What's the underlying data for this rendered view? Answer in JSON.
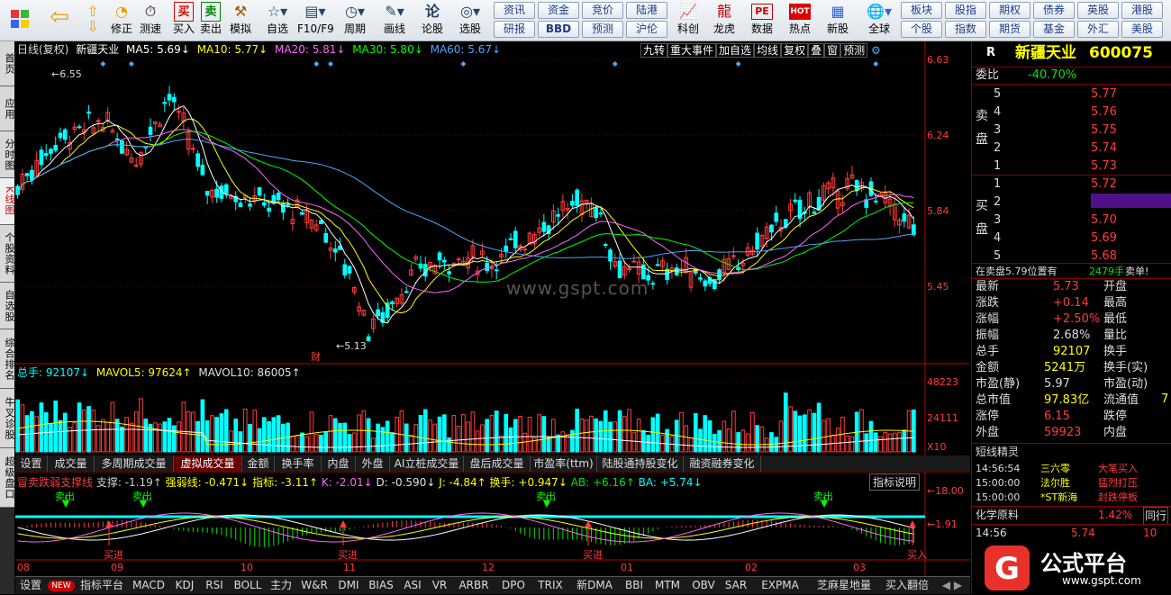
{
  "toolbar": {
    "buttons": [
      {
        "label": "",
        "icon": "windows-logo-icon"
      },
      {
        "label": "",
        "icon": "back-arrow-icon"
      },
      {
        "label": "",
        "icon": "up-down-arrows-icon"
      },
      {
        "label": "修正",
        "icon": "revise-icon"
      },
      {
        "label": "测速",
        "icon": "clock-icon"
      },
      {
        "label": "买入",
        "icon": "buy-icon",
        "glyph": "买"
      },
      {
        "label": "卖出",
        "icon": "sell-icon",
        "glyph": "卖"
      },
      {
        "label": "模拟",
        "icon": "gavel-icon"
      },
      {
        "label": "自选",
        "icon": "star-folder-icon"
      },
      {
        "label": "F10/F9",
        "icon": "window-icon"
      },
      {
        "label": "周期",
        "icon": "cycle-icon"
      },
      {
        "label": "画线",
        "icon": "pencil-icon"
      },
      {
        "label": "论股",
        "icon": "discuss-icon"
      },
      {
        "label": "选股",
        "icon": "stock-select-icon"
      }
    ],
    "grid": [
      [
        "资讯",
        "资金",
        "竞价",
        "陆港"
      ],
      [
        "研报",
        "BBD",
        "预测",
        "沪伦"
      ]
    ],
    "grid2": [
      [
        "板块",
        "股指",
        "期权",
        "债券",
        "英股",
        "港股"
      ],
      [
        "个股",
        "指数",
        "期货",
        "基金",
        "外汇",
        "美股"
      ]
    ],
    "buttons2": [
      {
        "label": "科创",
        "icon": "chart-icon"
      },
      {
        "label": "龙虎",
        "icon": "dragon-tiger-icon"
      },
      {
        "label": "数据",
        "icon": "pe-icon",
        "glyph": "PE"
      },
      {
        "label": "热点",
        "icon": "hot-icon",
        "glyph": "HOT"
      },
      {
        "label": "新股",
        "icon": "new-stock-icon"
      },
      {
        "label": "全球",
        "icon": "globe-icon"
      }
    ]
  },
  "left_tabs": [
    "首页",
    "应用",
    "分时图",
    "K线图",
    "个股资料",
    "自选股",
    "综合排名",
    "牛叉诊股",
    "超级盘口"
  ],
  "chart": {
    "header": {
      "title": "日线(复权)",
      "name": "新疆天业",
      "ma5": "MA5: 5.69↓",
      "ma10": "MA10: 5.77↓",
      "ma20": "MA20: 5.81↓",
      "ma30": "MA30: 5.80↓",
      "ma60": "MA60: 5.67↓"
    },
    "top_buttons": [
      "九转",
      "重大事件",
      "加自选",
      "均线",
      "复权",
      "叠",
      "窗",
      "预测"
    ],
    "price_axis": [
      "6.63",
      "6.24",
      "5.84",
      "5.45"
    ],
    "high_label": "6.55",
    "low_label": "5.13",
    "fin_mark": "财",
    "watermark": "www.gspt.com",
    "vol_header": {
      "total": "总手: 92107↓",
      "mavol5": "MAVOL5: 97624↑",
      "mavol10": "MAVOL10: 86005↑"
    },
    "vol_axis": [
      "48223",
      "24111",
      "X10"
    ],
    "indicator_tabs": [
      "设置",
      "成交量",
      "多周期成交量",
      "虚拟成交量",
      "金额",
      "换手率",
      "内盘",
      "外盘",
      "AI立桩成交量",
      "盘后成交量",
      "市盈率(ttm)",
      "陆股通持股变化",
      "融资融券变化"
    ],
    "indicator_active": 3,
    "ind_header": {
      "name": "冒卖跌弱支撑线",
      "support": "支撑: -1.19↑",
      "strong": "强弱线: -0.471↓",
      "index": "指标: -3.11↑",
      "k": "K: -2.01↓",
      "d": "D: -0.590↓",
      "j": "J: -4.84↑",
      "turn": "换手: +0.947↓",
      "ab": "AB: +6.16↑",
      "ba": "BA: +5.74↓"
    },
    "ind_explain": "指标说明",
    "ind_axis": [
      "18.00",
      "1.91"
    ],
    "sell_marks": [
      "卖出",
      "卖出",
      "卖出",
      "卖出"
    ],
    "buy_marks": [
      "买进",
      "买进",
      "买进",
      "买进",
      "买入"
    ],
    "x_labels": [
      "08",
      "09",
      "10",
      "11",
      "12",
      "01",
      "02",
      "03"
    ]
  },
  "bottom_tabs": [
    "设置",
    "指标平台",
    "MACD",
    "KDJ",
    "RSI",
    "BOLL",
    "主力",
    "W&R",
    "DMI",
    "BIAS",
    "ASI",
    "VR",
    "ARBR",
    "DPO",
    "TRIX",
    "新DMA",
    "BBI",
    "MTM",
    "OBV",
    "SAR",
    "EXPMA",
    "芝麻星地量",
    "买入翻倍"
  ],
  "bottom_new_badge": "NEW",
  "quote": {
    "r": "R",
    "stock_name": "新疆天业",
    "code": "600075",
    "weibi_label": "委比",
    "weibi": "-40.70%",
    "sell_label": "卖盘",
    "sells": [
      [
        "5",
        "5.77"
      ],
      [
        "4",
        "5.76"
      ],
      [
        "3",
        "5.75"
      ],
      [
        "2",
        "5.74"
      ],
      [
        "1",
        "5.73"
      ]
    ],
    "buy_label": "买盘",
    "buys": [
      [
        "1",
        "5.72"
      ],
      [
        "2",
        "5.71"
      ],
      [
        "3",
        "5.70"
      ],
      [
        "4",
        "5.69"
      ],
      [
        "5",
        "5.68"
      ]
    ],
    "notice": "在卖盘5.79位置有",
    "notice_vol": "2479手",
    "notice_type": "卖单!",
    "stats_left": [
      [
        "最新",
        "5.73"
      ],
      [
        "涨跌",
        "+0.14"
      ],
      [
        "涨幅",
        "+2.50%"
      ],
      [
        "振幅",
        "2.68%"
      ],
      [
        "总手",
        "92107"
      ],
      [
        "金额",
        "5241万"
      ],
      [
        "市盈(静)",
        "5.97"
      ],
      [
        "总市值",
        "97.83亿"
      ],
      [
        "涨停",
        "6.15"
      ],
      [
        "外盘",
        "59923"
      ]
    ],
    "stats_right": [
      "开盘",
      "最高",
      "最低",
      "量比",
      "换手",
      "换手(实)",
      "市盈(动)",
      "流通值",
      "跌停",
      "内盘"
    ],
    "right_cut": "7",
    "sprite_title": "短线精灵",
    "sprites": [
      [
        "14:56:54",
        "三六零",
        "大笔买入"
      ],
      [
        "15:00:00",
        "法尔胜",
        "猛烈打压"
      ],
      [
        "15:00:00",
        "*ST新海",
        "封跌停板"
      ]
    ],
    "sector": "化学原料",
    "sector_chg": "1.42%",
    "sector_more": "同行",
    "tick_time": "14:56",
    "tick_price": "5.74",
    "tick_vol": "10",
    "logo_text": "公式平台",
    "logo_url": "www.gspt.com"
  },
  "colors": {
    "up": "#ff3c3c",
    "down": "#00ffff",
    "ma5": "#ffffff",
    "ma10": "#ffff00",
    "ma20": "#ff66ff",
    "ma30": "#00ff00",
    "ma60": "#4da6ff"
  }
}
